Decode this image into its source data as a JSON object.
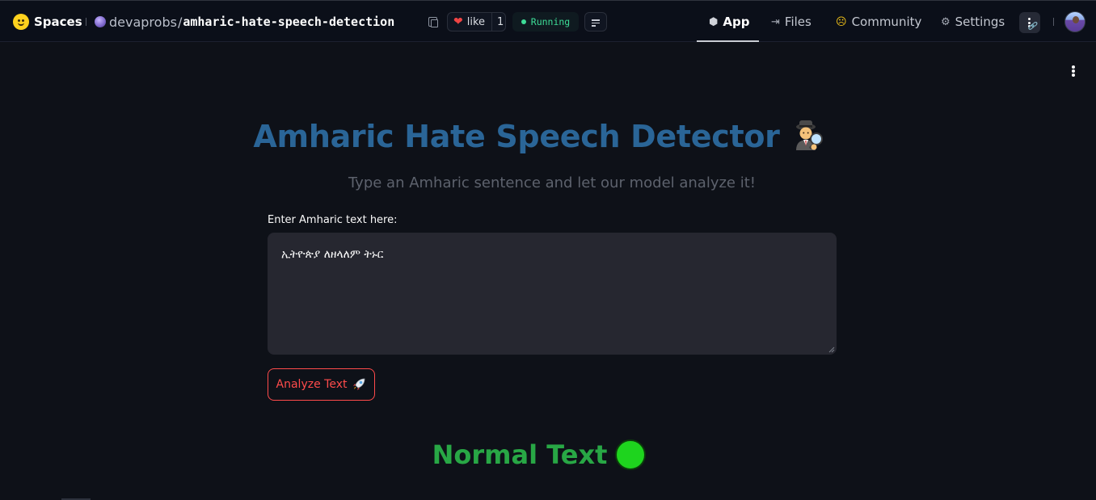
{
  "header": {
    "brand": "Spaces",
    "owner": "devaprobs",
    "slash": "/",
    "repo_name": "amharic-hate-speech-detection",
    "like_label": "like",
    "like_count": "1",
    "status": "Running",
    "nav": [
      {
        "label": "App",
        "icon": "cube-icon",
        "active": true
      },
      {
        "label": "Files",
        "icon": "files-icon",
        "active": false
      },
      {
        "label": "Community",
        "icon": "community-icon",
        "active": false
      },
      {
        "label": "Settings",
        "icon": "gear-icon",
        "active": false
      }
    ]
  },
  "app": {
    "title": "Amharic Hate Speech Detector",
    "subtitle": "Type an Amharic sentence and let our model analyze it!",
    "input_label": "Enter Amharic text here:",
    "input_value": "ኢትዮጵያ ለዘላለም ትኑር",
    "button_label": "Analyze Text",
    "result_text": "Normal Text"
  },
  "colors": {
    "title": "#2a6597",
    "accent_button": "#ff4b4b",
    "result": "#28a745",
    "status": "#3ddc97"
  }
}
